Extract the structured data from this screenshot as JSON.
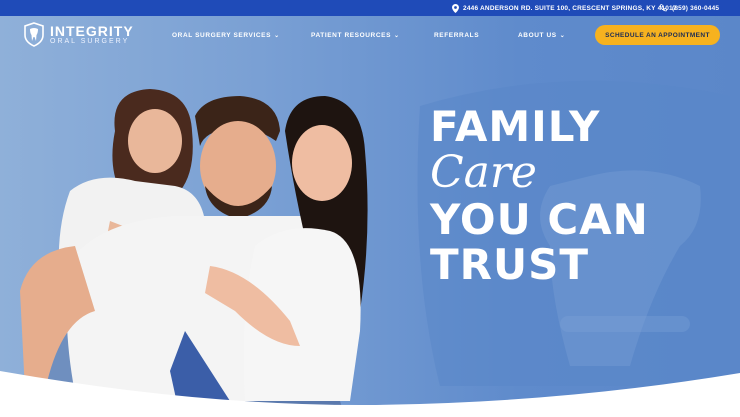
{
  "topbar": {
    "address": "2446 ANDERSON RD. SUITE 100, CRESCENT SPRINGS, KY 41017",
    "phone": "(859) 360-0445",
    "address_icon": "map-pin-icon",
    "phone_icon": "phone-icon"
  },
  "brand": {
    "name": "INTEGRITY",
    "tagline": "ORAL SURGERY",
    "logo_icon": "tooth-shield-icon"
  },
  "nav": {
    "items": [
      {
        "label": "ORAL SURGERY SERVICES",
        "has_dropdown": true
      },
      {
        "label": "PATIENT RESOURCES",
        "has_dropdown": true
      },
      {
        "label": "REFERRALS",
        "has_dropdown": false
      },
      {
        "label": "ABOUT US",
        "has_dropdown": true
      }
    ],
    "cta": "SCHEDULE AN APPOINTMENT"
  },
  "hero": {
    "line1": "FAMILY",
    "line2": "Care",
    "line3": "YOU CAN",
    "line4": "TRUST",
    "photo_alt": "family photo"
  },
  "colors": {
    "topbar": "#1f4bb8",
    "cta": "#f6b21f",
    "hero_blue": "#6f97d1"
  }
}
